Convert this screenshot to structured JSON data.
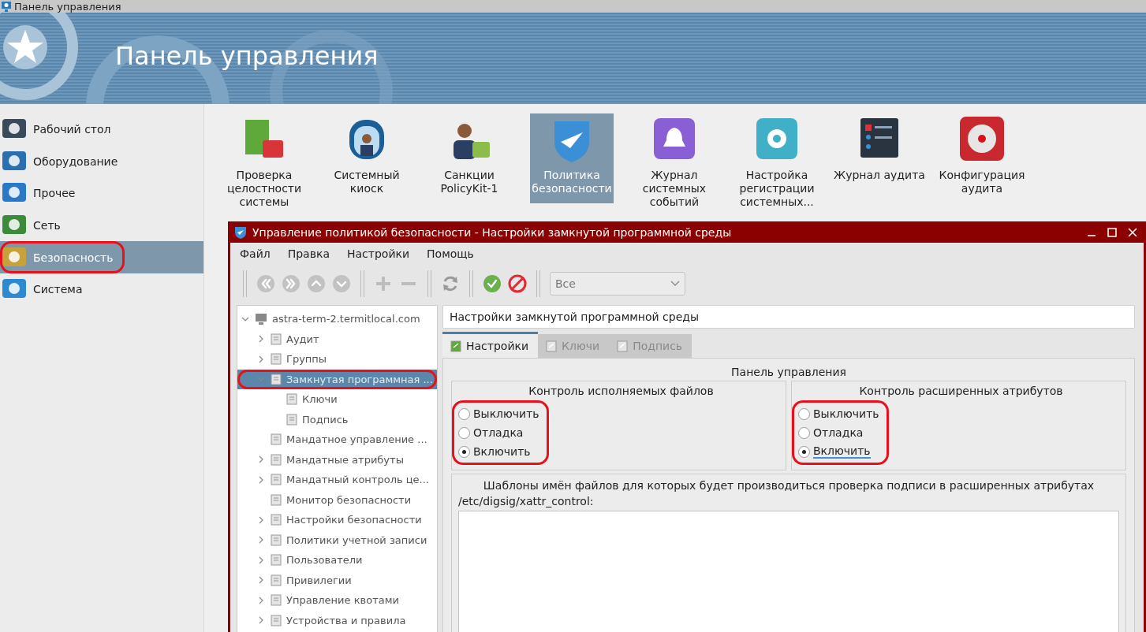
{
  "window": {
    "title": "Панель управления"
  },
  "banner": {
    "title": "Панель управления"
  },
  "sidebar": {
    "items": [
      {
        "label": "Рабочий стол",
        "kind": "desktop",
        "selected": false,
        "circled": false
      },
      {
        "label": "Оборудование",
        "kind": "hardware",
        "selected": false,
        "circled": false
      },
      {
        "label": "Прочее",
        "kind": "other",
        "selected": false,
        "circled": false
      },
      {
        "label": "Сеть",
        "kind": "network",
        "selected": false,
        "circled": false
      },
      {
        "label": "Безопасность",
        "kind": "security",
        "selected": true,
        "circled": true
      },
      {
        "label": "Система",
        "kind": "system",
        "selected": false,
        "circled": false
      }
    ]
  },
  "applets": [
    {
      "label": "Проверка целостности системы",
      "kind": "integrity",
      "selected": false
    },
    {
      "label": "Системный киоск",
      "kind": "kiosk",
      "selected": false
    },
    {
      "label": "Санкции PolicyKit-1",
      "kind": "policykit",
      "selected": false
    },
    {
      "label": "Политика безопасности",
      "kind": "policy",
      "selected": true
    },
    {
      "label": "Журнал системных событий",
      "kind": "journal",
      "selected": false
    },
    {
      "label": "Настройка регистрации системных...",
      "kind": "logging",
      "selected": false
    },
    {
      "label": "Журнал аудита",
      "kind": "auditlog",
      "selected": false
    },
    {
      "label": "Конфигурация аудита",
      "kind": "auditconf",
      "selected": false
    }
  ],
  "dialog": {
    "title": "Управление политикой безопасности - Настройки замкнутой программной среды",
    "menu": [
      "Файл",
      "Правка",
      "Настройки",
      "Помощь"
    ],
    "filter": {
      "value": "Все"
    },
    "tree": {
      "label": "astra-term-2.termitlocal.com",
      "expanded": true,
      "selected": false,
      "circled": false,
      "children": [
        {
          "label": "Аудит",
          "expanded": false,
          "selected": false,
          "circled": false
        },
        {
          "label": "Группы",
          "expanded": false,
          "selected": false,
          "circled": false
        },
        {
          "label": "Замкнутая программная ...",
          "expanded": true,
          "selected": true,
          "circled": true,
          "children": [
            {
              "label": "Ключи",
              "selected": false,
              "circled": false
            },
            {
              "label": "Подпись",
              "selected": false,
              "circled": false
            }
          ]
        },
        {
          "label": "Мандатное управление ...",
          "selected": false,
          "circled": false
        },
        {
          "label": "Мандатные атрибуты",
          "expanded": false,
          "selected": false,
          "circled": false
        },
        {
          "label": "Мандатный контроль це...",
          "expanded": false,
          "selected": false,
          "circled": false
        },
        {
          "label": "Монитор безопасности",
          "selected": false,
          "circled": false
        },
        {
          "label": "Настройки безопасности",
          "expanded": false,
          "selected": false,
          "circled": false
        },
        {
          "label": "Политики учетной записи",
          "expanded": false,
          "selected": false,
          "circled": false
        },
        {
          "label": "Пользователи",
          "expanded": false,
          "selected": false,
          "circled": false
        },
        {
          "label": "Привилегии",
          "expanded": false,
          "selected": false,
          "circled": false
        },
        {
          "label": "Управление квотами",
          "expanded": false,
          "selected": false,
          "circled": false
        },
        {
          "label": "Устройства и правила",
          "expanded": false,
          "selected": false,
          "circled": false
        }
      ]
    },
    "section_title": "Настройки замкнутой программной среды",
    "tabs": [
      {
        "label": "Настройки",
        "selected": true
      },
      {
        "label": "Ключи",
        "selected": false
      },
      {
        "label": "Подпись",
        "selected": false
      }
    ],
    "panel": {
      "title": "Панель управления",
      "groups": [
        {
          "title": "Контроль исполняемых файлов",
          "circled": true,
          "options": [
            {
              "label": "Выключить",
              "selected": false,
              "focused": false
            },
            {
              "label": "Отладка",
              "selected": false,
              "focused": false
            },
            {
              "label": "Включить",
              "selected": true,
              "focused": false
            }
          ]
        },
        {
          "title": "Контроль расширенных атрибутов",
          "circled": true,
          "options": [
            {
              "label": "Выключить",
              "selected": false,
              "focused": false
            },
            {
              "label": "Отладка",
              "selected": false,
              "focused": false
            },
            {
              "label": "Включить",
              "selected": true,
              "focused": true
            }
          ]
        }
      ],
      "templates": {
        "title": "Шаблоны имён файлов для которых будет производиться проверка подписи в расширенных атрибутах",
        "path": "/etc/digsig/xattr_control:"
      }
    }
  }
}
